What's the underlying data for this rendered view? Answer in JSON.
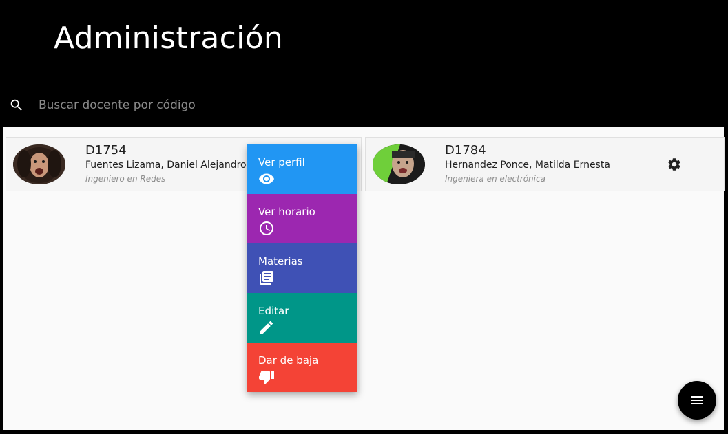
{
  "header": {
    "title": "Administración",
    "search_placeholder": "Buscar docente por código",
    "search_value": ""
  },
  "cards": [
    {
      "code": "D1754",
      "name": "Fuentes Lizama, Daniel Alejandro",
      "role": "Ingeniero en Redes"
    },
    {
      "code": "D1784",
      "name": "Hernandez Ponce, Matilda Ernesta",
      "role": "Ingeniera en electrónica"
    }
  ],
  "action_menu": {
    "items": [
      {
        "label": "Ver perfil",
        "icon": "eye-icon",
        "color": "#2196f3"
      },
      {
        "label": "Ver horario",
        "icon": "clock-icon",
        "color": "#9c27b0"
      },
      {
        "label": "Materias",
        "icon": "library-books-icon",
        "color": "#3f51b5"
      },
      {
        "label": "Editar",
        "icon": "pencil-icon",
        "color": "#009688"
      },
      {
        "label": "Dar de baja",
        "icon": "thumb-down-icon",
        "color": "#f44336"
      }
    ]
  },
  "fab": {
    "icon": "menu-icon"
  },
  "colors": {
    "header_bg": "#000000",
    "content_bg": "#fafafa",
    "card_bg": "#f5f5f5"
  }
}
